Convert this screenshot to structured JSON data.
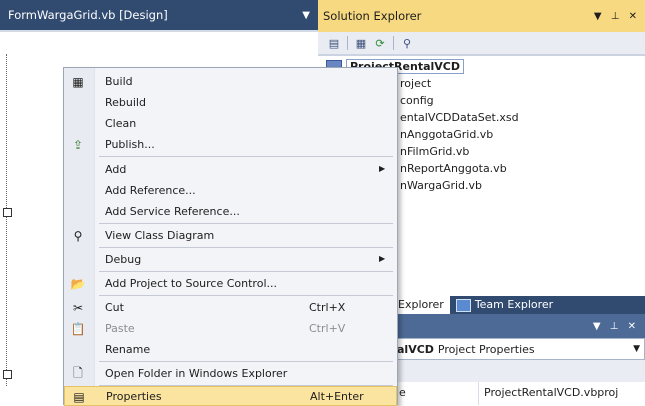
{
  "design_tab": {
    "title": "FormWargaGrid.vb [Design]"
  },
  "solution_explorer": {
    "title": "Solution Explorer",
    "project_root": "ProjectRentalVCD",
    "tree_items": [
      "roject",
      "config",
      "entalVCDDataSet.xsd",
      "nAnggotaGrid.vb",
      "nFilmGrid.vb",
      "nReportAnggota.vb",
      "nWargaGrid.vb"
    ]
  },
  "bottom_tabs": {
    "explorer": "Explorer",
    "team_explorer": "Team Explorer"
  },
  "properties": {
    "object_name_bold": "alVCD",
    "object_type": "Project Properties",
    "row_name": "le",
    "row_value": "ProjectRentalVCD.vbproj"
  },
  "context_menu": {
    "build": "Build",
    "rebuild": "Rebuild",
    "clean": "Clean",
    "publish": "Publish...",
    "add": "Add",
    "add_reference": "Add Reference...",
    "add_service_reference": "Add Service Reference...",
    "view_class_diagram": "View Class Diagram",
    "debug": "Debug",
    "add_to_source_control": "Add Project to Source Control...",
    "cut": "Cut",
    "cut_shortcut": "Ctrl+X",
    "paste": "Paste",
    "paste_shortcut": "Ctrl+V",
    "rename": "Rename",
    "open_folder": "Open Folder in Windows Explorer",
    "properties": "Properties",
    "properties_shortcut": "Alt+Enter"
  },
  "icons": {
    "build": "build-icon",
    "publish": "publish-icon",
    "class_diagram": "class-diagram-icon",
    "source_control": "source-control-icon",
    "cut": "scissors-icon",
    "paste": "paste-icon",
    "open_folder": "open-folder-icon",
    "properties": "properties-icon"
  },
  "colors": {
    "header_dark": "#304a70",
    "solution_header": "#f7d981",
    "menu_bg": "#f3f4f8",
    "highlight": "#fbe3a0"
  }
}
